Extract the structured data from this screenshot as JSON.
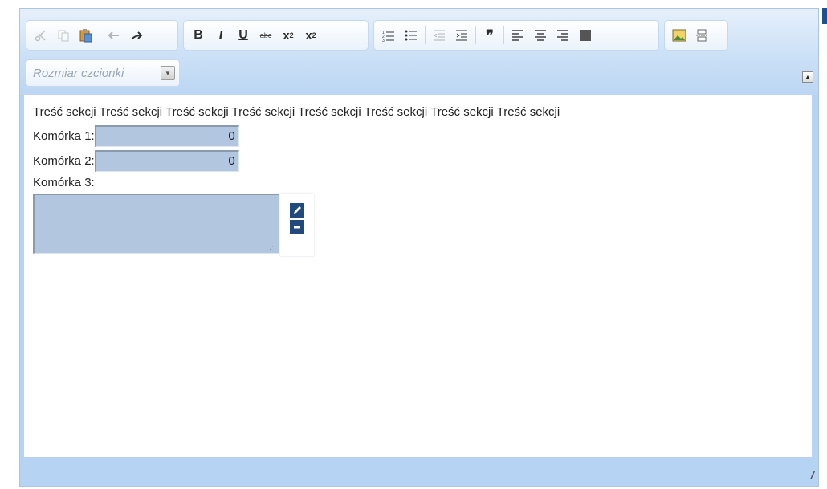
{
  "toolbar": {
    "groups": [
      {
        "buttons": [
          {
            "icon": "cut-icon",
            "glyph": "✂",
            "disabled": true
          },
          {
            "icon": "copy-icon",
            "glyph": "⎘",
            "disabled": true
          },
          {
            "icon": "paste-icon",
            "glyph": "📋",
            "disabled": false
          }
        ],
        "after_sep": [
          {
            "icon": "undo-icon",
            "glyph": "↶",
            "disabled": true
          },
          {
            "icon": "redo-icon",
            "glyph": "➦",
            "disabled": false
          }
        ]
      },
      {
        "format": {
          "bold": "B",
          "italic": "I",
          "underline": "U",
          "strike": "abc",
          "subscript_base": "x",
          "subscript_mark": "2",
          "superscript_base": "x",
          "superscript_mark": "2"
        }
      },
      {
        "paragraph": [
          {
            "icon": "numbered-list-icon",
            "glyph": "☰"
          },
          {
            "icon": "bulleted-list-icon",
            "glyph": "☷"
          },
          {
            "icon": "outdent-icon",
            "glyph": "⇤",
            "disabled": true
          },
          {
            "icon": "indent-icon",
            "glyph": "⇥"
          },
          {
            "icon": "blockquote-icon",
            "glyph": "99"
          },
          {
            "icon": "align-left-icon",
            "glyph": "≡"
          },
          {
            "icon": "align-center-icon",
            "glyph": "≣"
          },
          {
            "icon": "align-right-icon",
            "glyph": "≡"
          },
          {
            "icon": "align-justify-icon",
            "glyph": "▤"
          }
        ]
      },
      {
        "insert": [
          {
            "icon": "image-icon",
            "glyph": "▣"
          },
          {
            "icon": "page-break-icon",
            "glyph": "⊟"
          }
        ]
      }
    ],
    "font_size_label": "Rozmiar czcionki"
  },
  "content": {
    "section_text": "Treść sekcji Treść sekcji Treść sekcji Treść sekcji Treść sekcji Treść sekcji Treść sekcji Treść sekcji",
    "cells": [
      {
        "label": "Komórka 1:",
        "value": "0"
      },
      {
        "label": "Komórka 2:",
        "value": "0"
      }
    ],
    "cell3_label": "Komórka 3:"
  },
  "colors": {
    "chrome": "#b7d3f3",
    "field_bg": "#b2c7df",
    "tool_button": "#20497c"
  }
}
